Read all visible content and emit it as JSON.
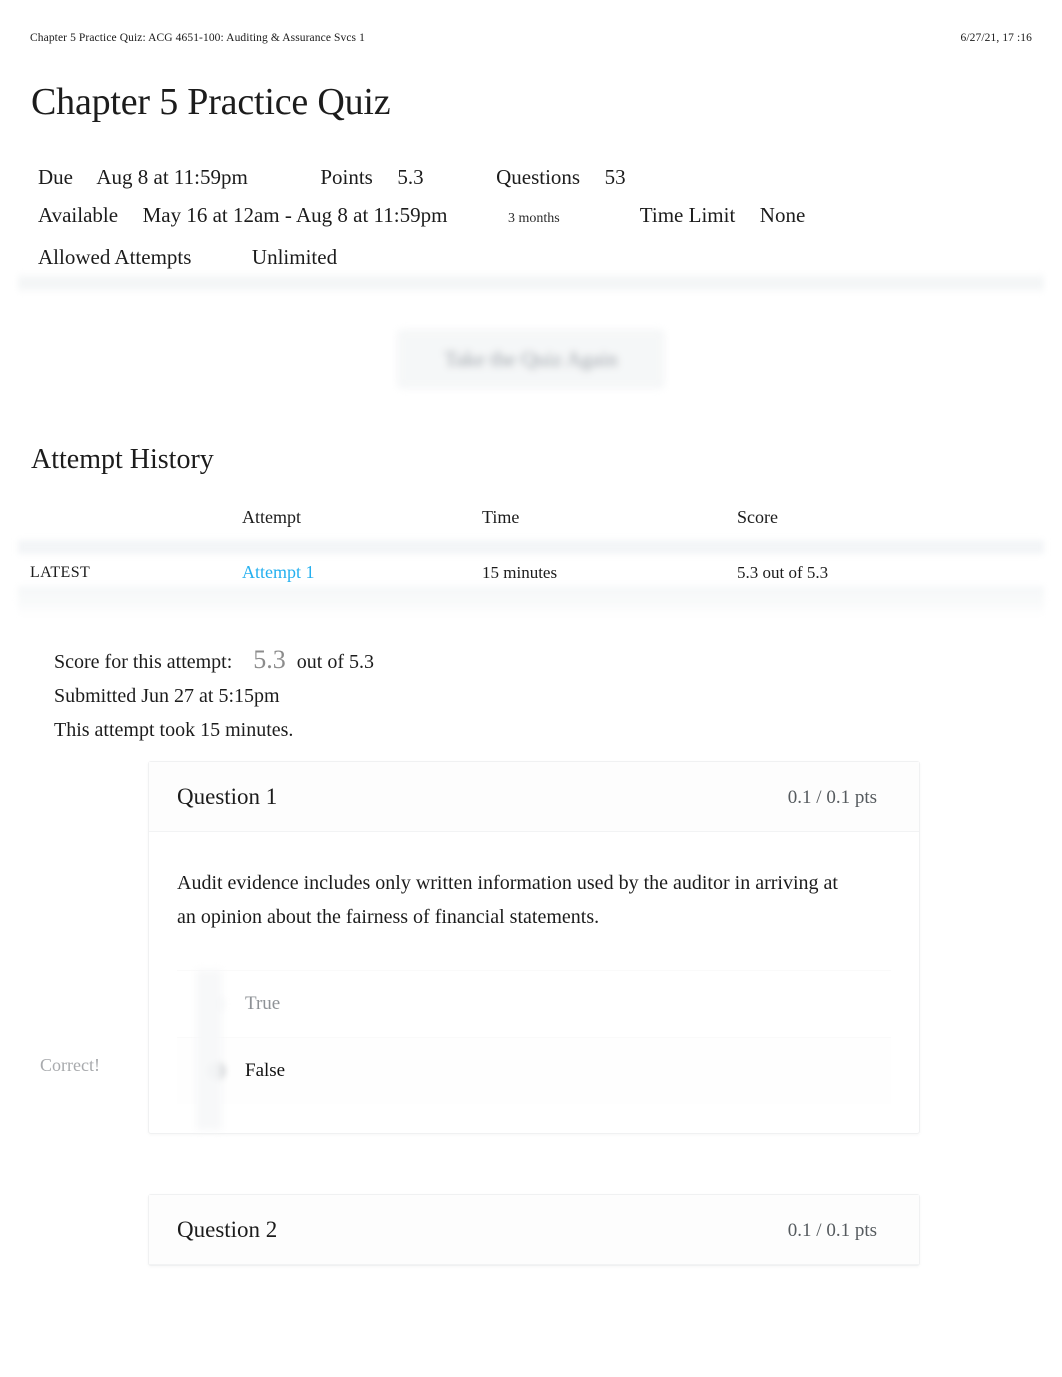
{
  "print_header": {
    "document_title": "Chapter 5 Practice Quiz: ACG 4651-100: Auditing & Assurance Svcs 1",
    "printed_at": "6/27/21, 17  :16"
  },
  "page_title": "Chapter 5 Practice Quiz",
  "quiz_meta": {
    "due_label": "Due",
    "due_value": "Aug 8 at 11:59pm",
    "points_label": "Points",
    "points_value": "5.3",
    "questions_label": "Questions",
    "questions_value": "53",
    "available_label": "Available",
    "available_value": "May 16 at 12am - Aug 8 at 11:59pm",
    "available_duration": "3 months",
    "time_limit_label": "Time Limit",
    "time_limit_value": "None",
    "allowed_attempts_label": "Allowed Attempts",
    "allowed_attempts_value": "Unlimited"
  },
  "retake_button_label": "Take the Quiz Again",
  "attempt_history": {
    "heading": "Attempt History",
    "columns": [
      "",
      "Attempt",
      "Time",
      "Score"
    ],
    "rows": [
      {
        "kept": "LATEST",
        "attempt": "Attempt 1",
        "time": "15 minutes",
        "score": "5.3 out of 5.3"
      }
    ]
  },
  "score_summary": {
    "score_label": "Score for this attempt:",
    "score_value": "5.3",
    "score_out_of": "out of 5.3",
    "submitted": "Submitted Jun 27 at 5:15pm",
    "duration": "This attempt took 15 minutes."
  },
  "questions": [
    {
      "name": "Question 1",
      "points": "0.1 / 0.1 pts",
      "text": "Audit evidence includes only written information used by the auditor in arriving at an opinion about the fairness of financial statements.",
      "correct_flag": "Correct!",
      "answers": [
        {
          "label": "True",
          "selected": false
        },
        {
          "label": "False",
          "selected": true
        }
      ]
    },
    {
      "name": "Question 2",
      "points": "0.1 / 0.1 pts"
    }
  ],
  "colors": {
    "link_blue": "#25b0ef",
    "text_dark": "#1c1c1c",
    "muted_gray": "#8e9296",
    "score_gray": "#8c8c8c",
    "card_border": "#f0f1f2"
  }
}
